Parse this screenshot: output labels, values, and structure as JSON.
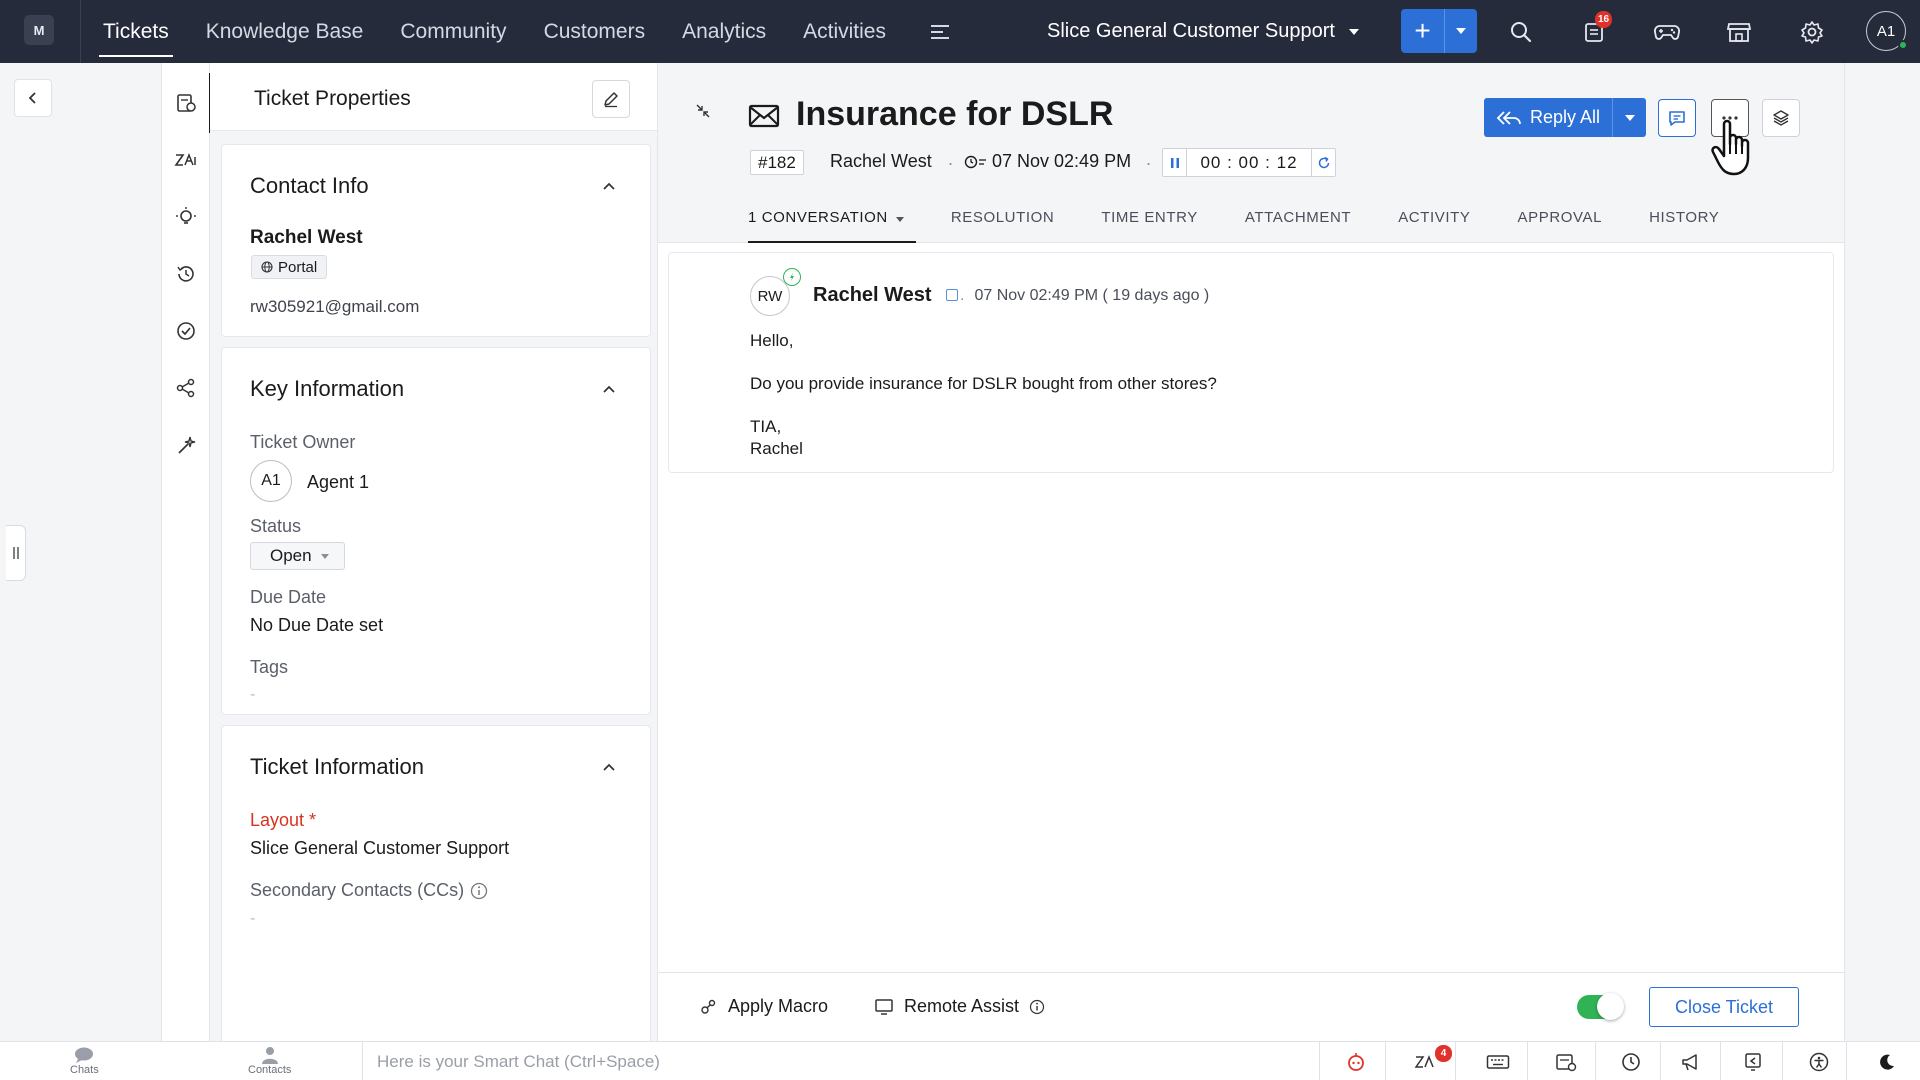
{
  "app": {
    "logo_text": "M"
  },
  "topnav": {
    "items": [
      "Tickets",
      "Knowledge Base",
      "Community",
      "Customers",
      "Analytics",
      "Activities"
    ],
    "active": "Tickets",
    "department": "Slice General Customer Support",
    "notification_count": "16",
    "user_initials": "A1"
  },
  "properties": {
    "title": "Ticket Properties",
    "contact_info": {
      "title": "Contact Info",
      "name": "Rachel West",
      "channel": "Portal",
      "email": "rw305921@gmail.com"
    },
    "key_information": {
      "title": "Key Information",
      "owner_label": "Ticket Owner",
      "owner_initials": "A1",
      "owner_name": "Agent 1",
      "status_label": "Status",
      "status_value": "Open",
      "due_label": "Due Date",
      "due_value": "No Due Date set",
      "tags_label": "Tags",
      "tags_value": "-"
    },
    "ticket_information": {
      "title": "Ticket Information",
      "layout_label": "Layout *",
      "layout_value": "Slice General Customer Support",
      "cc_label": "Secondary Contacts (CCs)",
      "cc_value": "-"
    }
  },
  "ticket": {
    "subject": "Insurance for DSLR",
    "id": "#182",
    "contact": "Rachel West",
    "created": "07 Nov 02:49 PM",
    "timer": "00 : 00 : 12",
    "reply_all_label": "Reply All",
    "tabs": [
      "1 CONVERSATION",
      "RESOLUTION",
      "TIME ENTRY",
      "ATTACHMENT",
      "ACTIVITY",
      "APPROVAL",
      "HISTORY"
    ],
    "active_tab": "1 CONVERSATION"
  },
  "thread": {
    "avatar_initials": "RW",
    "sender": "Rachel West",
    "time": "07 Nov 02:49 PM ( 19 days ago )",
    "lines": [
      "Hello,",
      "Do you provide insurance for DSLR bought from other stores?",
      "TIA,",
      "Rachel"
    ]
  },
  "footer": {
    "apply_macro": "Apply Macro",
    "remote_assist": "Remote Assist",
    "toggle_on": true,
    "close_ticket": "Close Ticket"
  },
  "bottombar": {
    "chats": "Chats",
    "contacts": "Contacts",
    "smart_chat_placeholder": "Here is your Smart Chat (Ctrl+Space)",
    "zia_badge": "4"
  },
  "colors": {
    "topbar": "#262b3c",
    "accent": "#2c6fd6",
    "success": "#2fb355",
    "danger": "#e0322a",
    "required": "#d9331f"
  },
  "icons": [
    "search-icon",
    "feeds-icon",
    "game-controller-icon",
    "marketplace-icon",
    "gear-icon",
    "envelope-icon",
    "pause-icon",
    "refresh-icon",
    "comment-icon",
    "more-icon",
    "layers-icon",
    "edit-icon",
    "chevron-up-icon",
    "globe-icon",
    "info-icon",
    "macro-icon",
    "monitor-icon",
    "hand-cursor-icon"
  ]
}
